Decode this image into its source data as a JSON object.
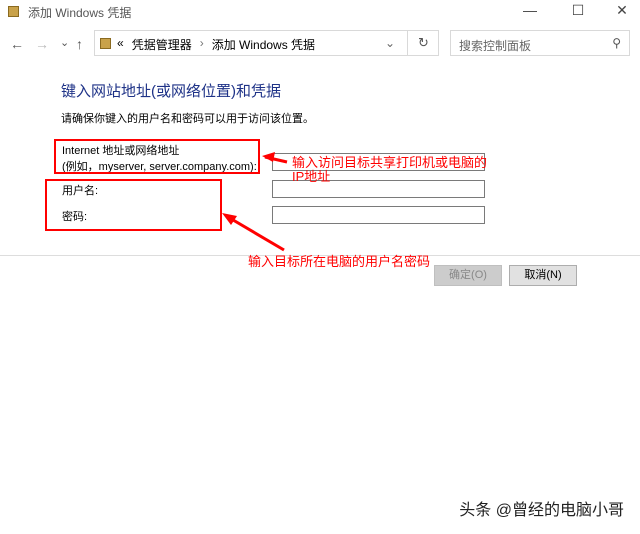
{
  "window": {
    "title": "添加 Windows 凭据",
    "minimize": "—",
    "maximize": "☐",
    "close": "✕"
  },
  "nav": {
    "back": "←",
    "forward": "→",
    "recent": "⌄",
    "up": "↑"
  },
  "address": {
    "chevrons": "«",
    "crumbs": [
      "凭据管理器",
      "添加 Windows 凭据"
    ],
    "separator": "›",
    "dropdown": "⌄",
    "refresh": "↻"
  },
  "search": {
    "placeholder": "搜索控制面板",
    "icon": "⚲"
  },
  "form": {
    "heading": "键入网站地址(或网络位置)和凭据",
    "subtitle": "请确保你键入的用户名和密码可以用于访问该位置。",
    "address_label_1": "Internet 地址或网络地址",
    "address_label_2": "(例如，myserver, server.company.com):",
    "address_value": "",
    "username_label": "用户名:",
    "username_value": "",
    "password_label": "密码:",
    "password_value": ""
  },
  "annotations": {
    "address_note_1": "输入访问目标共享打印机或电脑的",
    "address_note_2": "IP地址",
    "credentials_note": "输入目标所在电脑的用户名密码",
    "color": "#ff0000"
  },
  "buttons": {
    "ok": "确定(O)",
    "cancel": "取消(N)"
  },
  "watermark": "头条 @曾经的电脑小哥"
}
